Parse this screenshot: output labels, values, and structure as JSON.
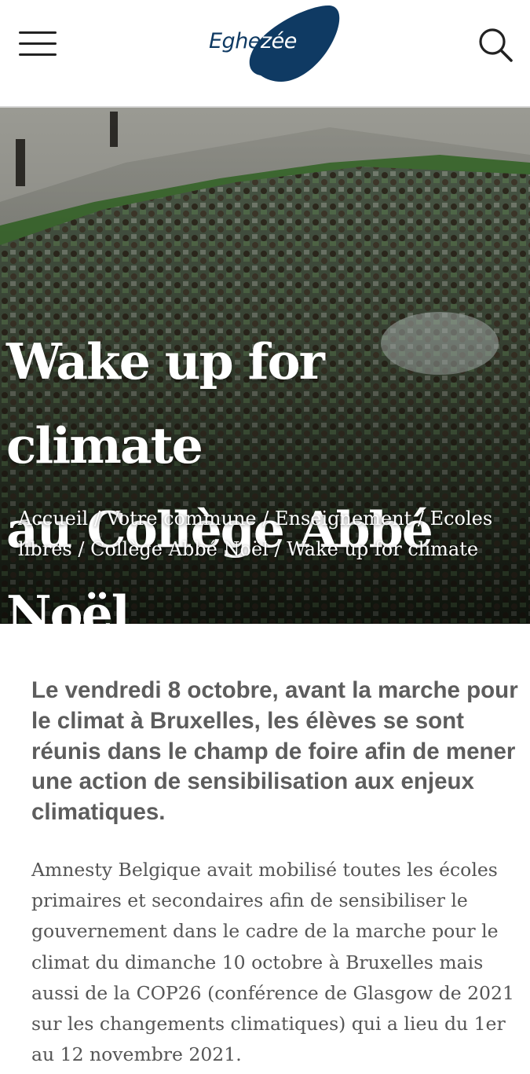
{
  "header": {
    "logo_text_light": "Eghe",
    "logo_text_dark": "zée",
    "logo_color": "#0f3a63",
    "menu_icon": "hamburger-menu-icon",
    "search_icon": "magnifier-search-icon"
  },
  "hero": {
    "title_line1": "Wake up for climate",
    "title_line2": "au Collège Abbé Noël",
    "breadcrumb": {
      "home": "Accueil",
      "commune": "Votre commune",
      "enseignement": "Enseignement",
      "ecoles": "Ecoles libres",
      "college": "Collège Abbé Noël",
      "current": "Wake up for climate",
      "separator": " / "
    }
  },
  "article": {
    "lead": "Le vendredi 8 octobre, avant la marche pour le climat à Bruxelles, les élèves se sont réunis dans le champ de foire afin de mener une action de sensibilisation aux enjeux climatiques.",
    "paragraph": "Amnesty Belgique avait mobilisé toutes les écoles primaires et secondaires afin de sensibiliser le gouvernement dans le cadre de la marche pour le climat du dimanche 10 octobre à Bruxelles mais aussi de la COP26 (conférence de Glasgow de 2021 sur les changements climatiques) qui a lieu du 1er au 12 novembre 2021."
  }
}
